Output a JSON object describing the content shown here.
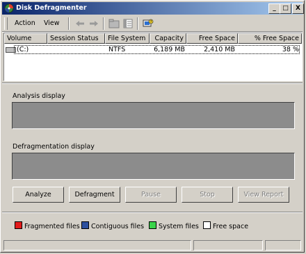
{
  "window": {
    "title": "Disk Defragmenter"
  },
  "titlebar_buttons": {
    "minimize": "_",
    "maximize": "□",
    "close": "X"
  },
  "menu": {
    "action": "Action",
    "view": "View"
  },
  "toolbar": {
    "icons": [
      "back-arrow-icon",
      "forward-arrow-icon",
      "up-folder-icon",
      "properties-icon",
      "help-icon"
    ]
  },
  "list": {
    "headers": [
      "Volume",
      "Session Status",
      "File System",
      "Capacity",
      "Free Space",
      "% Free Space"
    ],
    "rows": [
      {
        "volume": "(C:)",
        "session_status": "",
        "file_system": "NTFS",
        "capacity": "6,189 MB",
        "free_space": "2,410 MB",
        "pct_free": "38 %"
      }
    ]
  },
  "panels": {
    "analysis_label": "Analysis display",
    "defrag_label": "Defragmentation display"
  },
  "buttons": {
    "analyze": "Analyze",
    "defragment": "Defragment",
    "pause": "Pause",
    "stop": "Stop",
    "view_report": "View Report"
  },
  "legend": [
    {
      "label": "Fragmented files",
      "color": "#e21b1b"
    },
    {
      "label": "Contiguous files",
      "color": "#2c4f9e"
    },
    {
      "label": "System files",
      "color": "#39d34a"
    },
    {
      "label": "Free space",
      "color": "#ffffff"
    }
  ]
}
